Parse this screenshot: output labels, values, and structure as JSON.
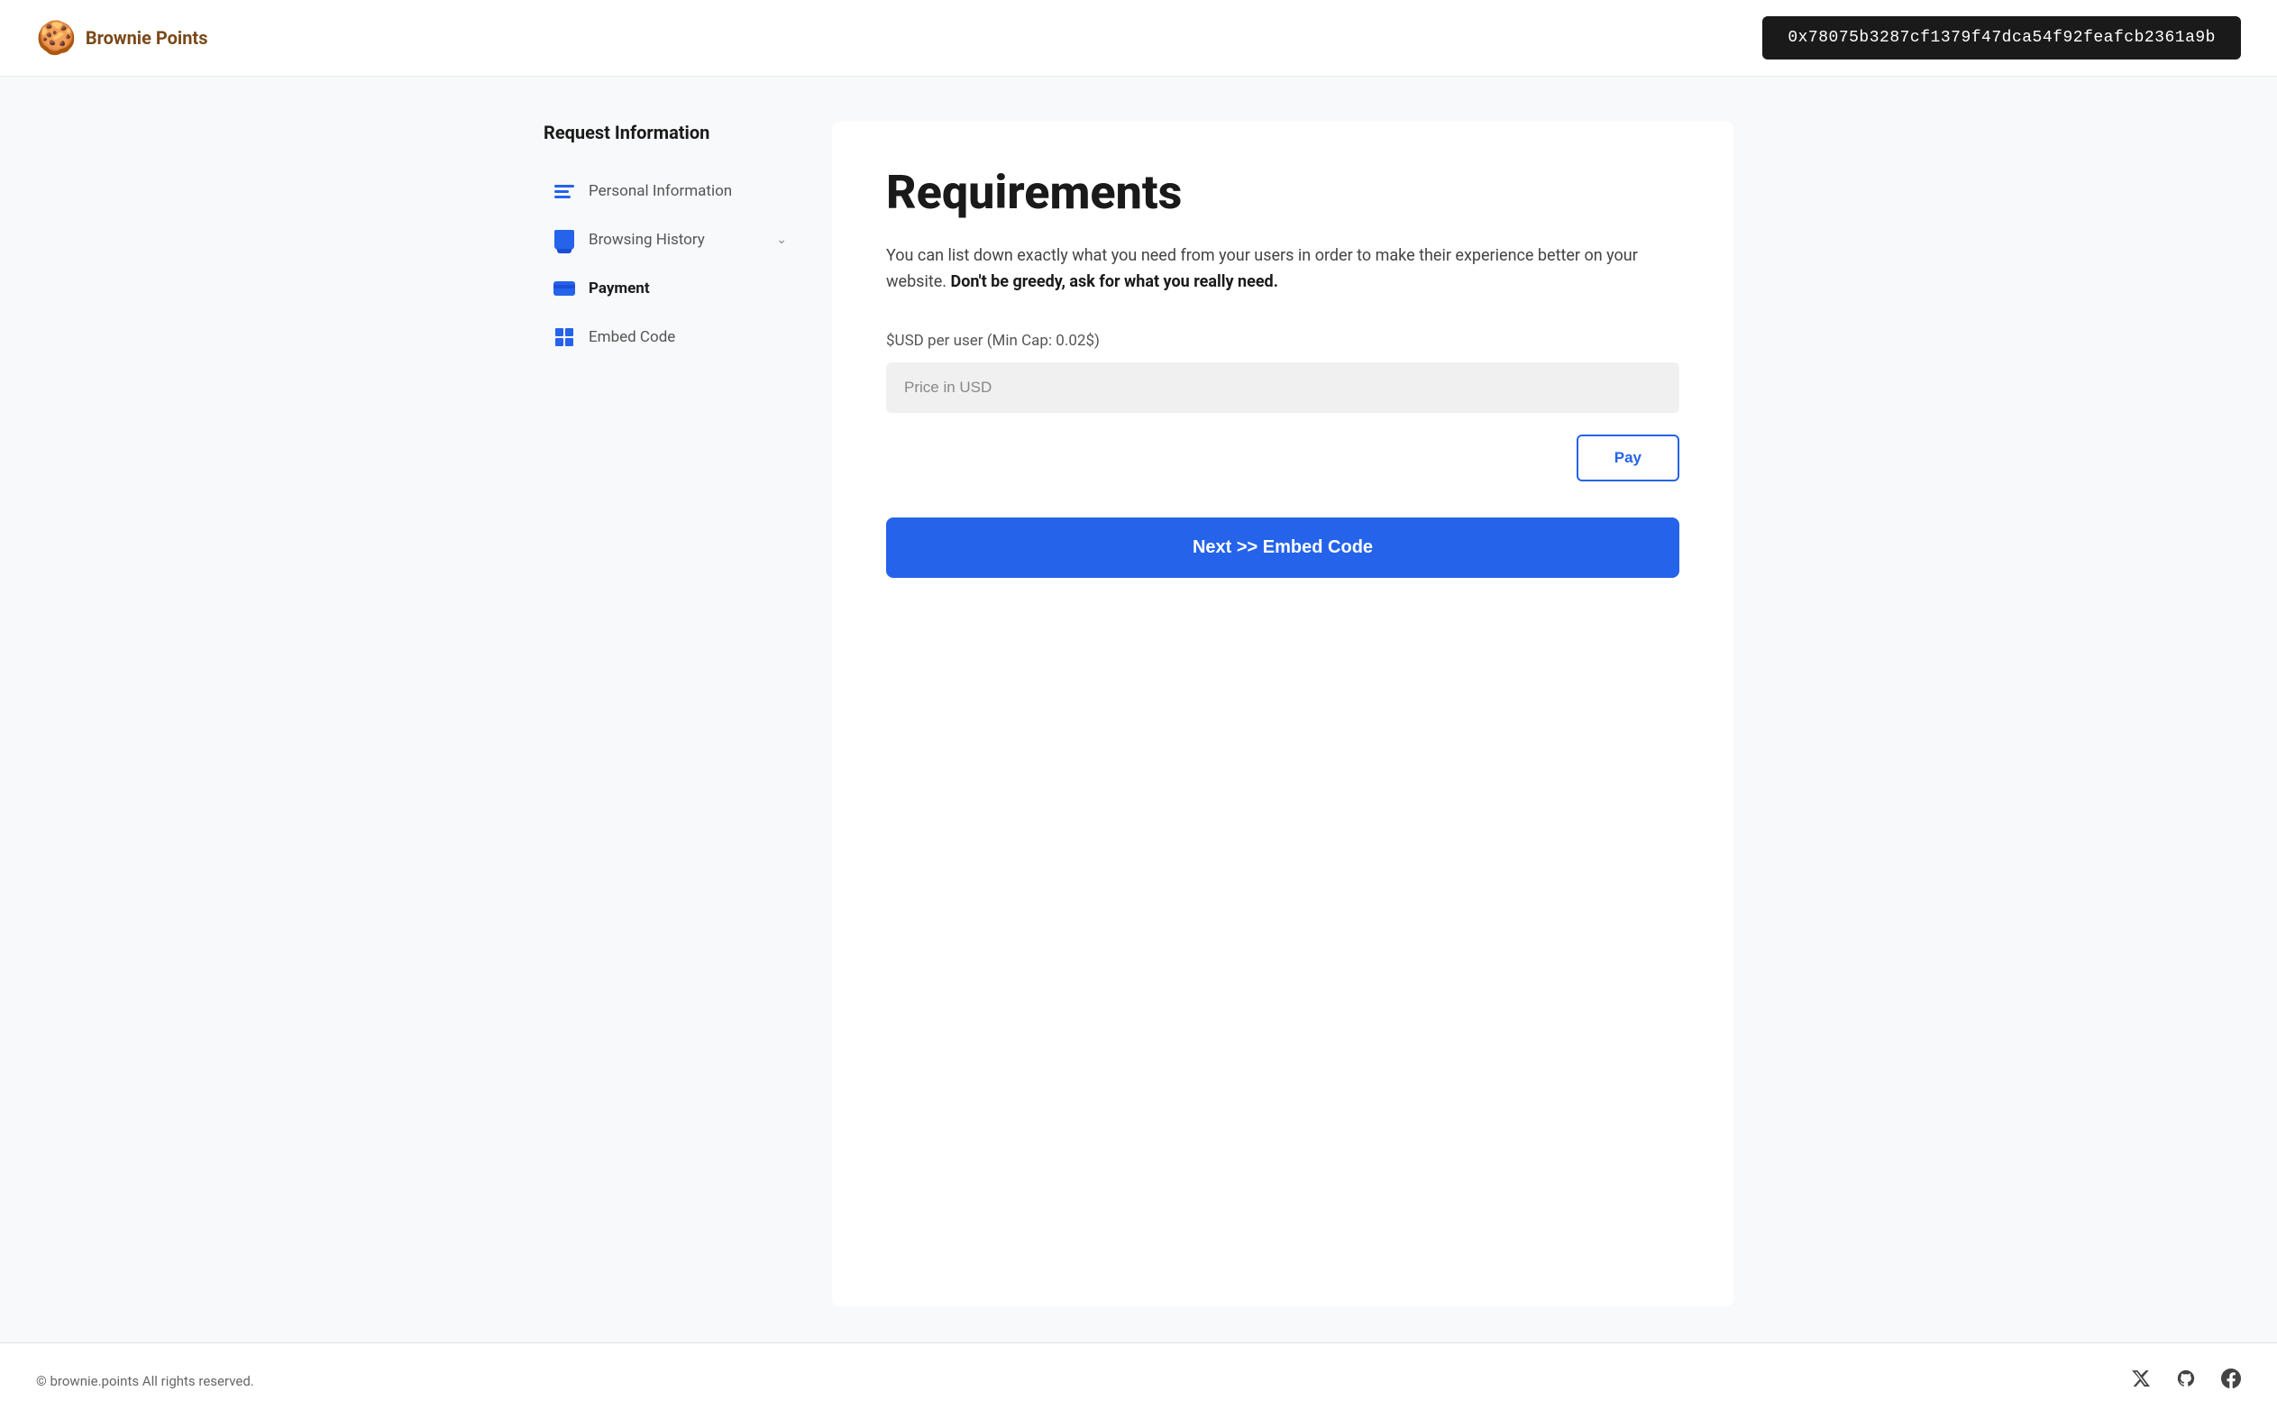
{
  "header": {
    "logo_emoji": "🍪",
    "logo_text": "Brownie Points",
    "wallet_address": "0x78075b3287cf1379f47dca54f92feafcb2361a9b"
  },
  "sidebar": {
    "title": "Request Information",
    "items": [
      {
        "id": "personal-information",
        "label": "Personal Information",
        "icon": "personal",
        "active": false,
        "has_chevron": false
      },
      {
        "id": "browsing-history",
        "label": "Browsing History",
        "icon": "browsing",
        "active": false,
        "has_chevron": true
      },
      {
        "id": "payment",
        "label": "Payment",
        "icon": "payment",
        "active": true,
        "has_chevron": false
      },
      {
        "id": "embed-code",
        "label": "Embed Code",
        "icon": "embed",
        "active": false,
        "has_chevron": false
      }
    ]
  },
  "content": {
    "title": "Requirements",
    "description_plain": "You can list down exactly what you need from your users in order to make their experience better on your website. ",
    "description_bold": "Don't be greedy, ask for what you really need.",
    "price_label": "$USD per user (Min Cap: 0.02$)",
    "price_placeholder": "Price in USD",
    "pay_button_label": "Pay",
    "next_button_label": "Next >> Embed Code"
  },
  "footer": {
    "copyright": "© brownie.points All rights reserved."
  }
}
